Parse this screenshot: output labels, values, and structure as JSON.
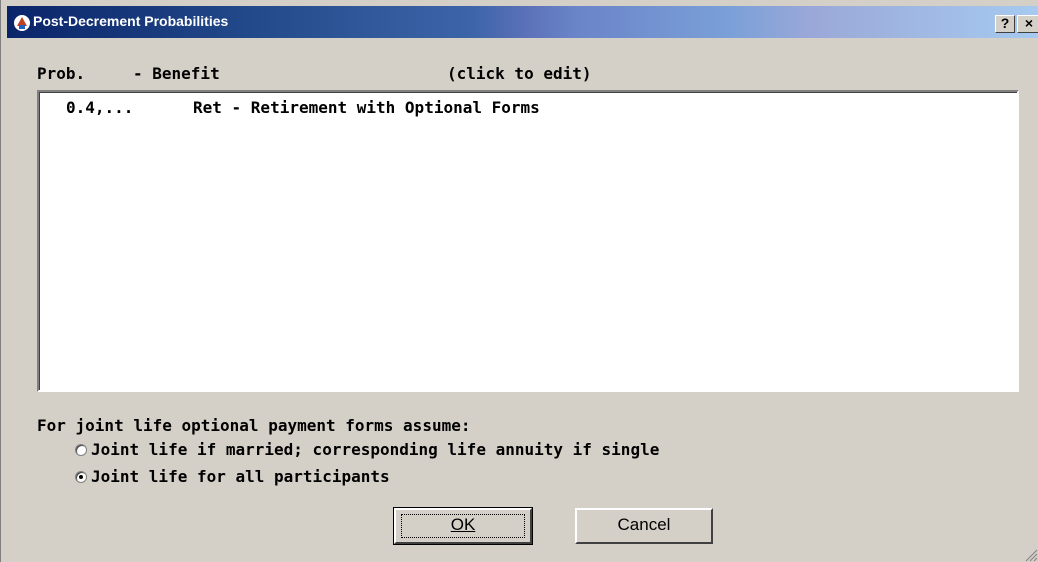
{
  "window": {
    "title": "Post-Decrement Probabilities",
    "help_label": "?",
    "close_label": "×"
  },
  "header": {
    "prob_label": "Prob.",
    "benefit_label": "- Benefit",
    "hint": "(click to edit)"
  },
  "list": {
    "rows": [
      {
        "prob": "0.4,...",
        "benefit": "Ret - Retirement with Optional Forms"
      }
    ]
  },
  "options": {
    "label": "For joint life optional payment forms assume:",
    "radios": [
      {
        "label": "Joint life if married; corresponding life annuity if single",
        "selected": false
      },
      {
        "label": "Joint life for all participants",
        "selected": true
      }
    ]
  },
  "buttons": {
    "ok_label": "OK",
    "cancel_label": "Cancel"
  }
}
